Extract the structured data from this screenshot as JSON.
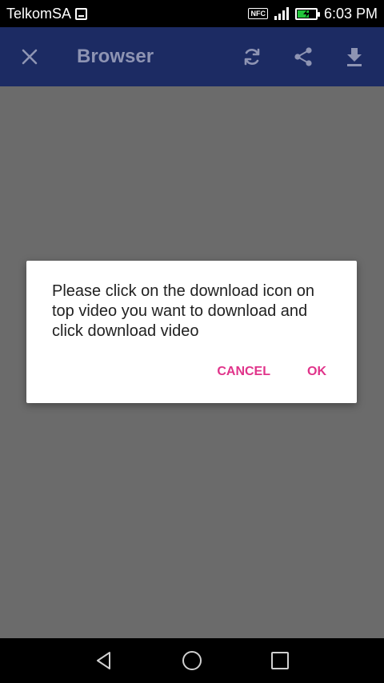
{
  "status_bar": {
    "carrier": "TelkomSA",
    "nfc_label": "NFC",
    "time": "6:03 PM"
  },
  "toolbar": {
    "title": "Browser",
    "icons": [
      "close-icon",
      "refresh-icon",
      "share-icon",
      "download-icon"
    ]
  },
  "dialog": {
    "message": "Please click on the download icon on top video you want to download and click download video",
    "cancel_label": "CANCEL",
    "ok_label": "OK"
  },
  "navbar": {
    "icons": [
      "back-icon",
      "home-icon",
      "recents-icon"
    ]
  },
  "colors": {
    "toolbar_bg": "#1c2b63",
    "toolbar_fg": "#8e94b3",
    "dim_bg": "#6b6b6b",
    "accent": "#e0338a"
  }
}
